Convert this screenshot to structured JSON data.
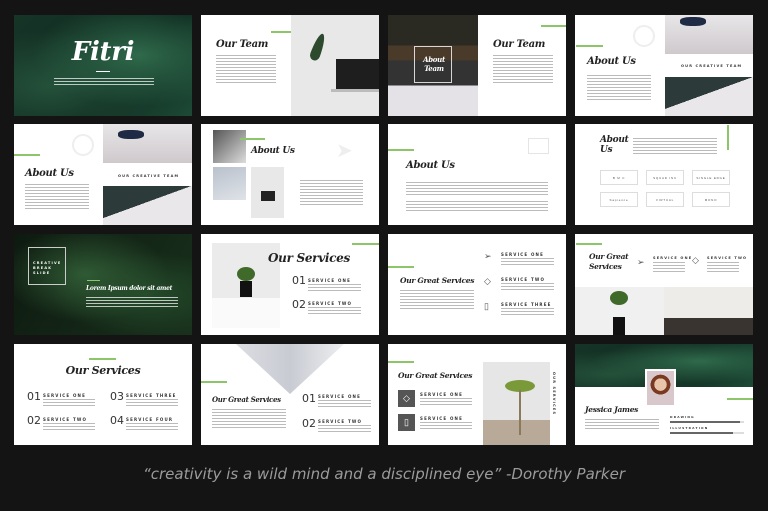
{
  "slides": {
    "cover": {
      "title": "Fitri"
    },
    "our_team": {
      "title": "Our Team"
    },
    "our_team_photo": {
      "overlay": "About Team",
      "title": "Our Team"
    },
    "about_us_1": {
      "title": "About Us",
      "tagline": "OUR CREATIVE TEAM"
    },
    "about_us_2": {
      "title": "About Us",
      "tagline": "OUR CREATIVE TEAM"
    },
    "about_us_3": {
      "title": "About Us"
    },
    "about_us_4": {
      "title": "About Us"
    },
    "about_us_logos": {
      "title_line1": "About",
      "title_line2": "Us",
      "logos": [
        "B M C",
        "SQUAD INC",
        "SINGLE EDGE",
        "Sapience",
        "VIRTUAL",
        "MONO"
      ]
    },
    "break": {
      "box": "CREATIVE BREAK SLIDE",
      "heading": "Lorem Ipsum dolor sit amet"
    },
    "services_1": {
      "title": "Our Services",
      "items": [
        {
          "num": "01",
          "label": "SERVICE ONE"
        },
        {
          "num": "02",
          "label": "SERVICE TWO"
        }
      ]
    },
    "great_services_1": {
      "title": "Our Great Services",
      "items": [
        "SERVICE ONE",
        "SERVICE TWO",
        "SERVICE THREE"
      ]
    },
    "great_services_2": {
      "title_line1": "Our Great",
      "title_line2": "Services",
      "items": [
        "SERVICE ONE",
        "SERVICE TWO"
      ]
    },
    "services_2": {
      "title": "Our Services",
      "items": [
        {
          "num": "01",
          "label": "SERVICE ONE"
        },
        {
          "num": "02",
          "label": "SERVICE TWO"
        },
        {
          "num": "03",
          "label": "SERVICE THREE"
        },
        {
          "num": "04",
          "label": "SERVICE FOUR"
        }
      ]
    },
    "great_services_3": {
      "title": "Our Great Services",
      "items": [
        {
          "num": "01",
          "label": "SERVICE ONE"
        },
        {
          "num": "02",
          "label": "SERVICE TWO"
        }
      ]
    },
    "great_services_4": {
      "title": "Our Great Services",
      "items": [
        "SERVICE ONE",
        "SERVICE ONE"
      ],
      "side": "OUR SERVICES"
    },
    "profile": {
      "name": "Jessica James",
      "skills": [
        {
          "label": "DRAWING",
          "level": 0.95
        },
        {
          "label": "ILLUSTRATION",
          "level": 0.85
        }
      ]
    }
  },
  "accent": "#8cc56a",
  "quote": "“creativity is a wild mind and a disciplined eye” -Dorothy Parker"
}
